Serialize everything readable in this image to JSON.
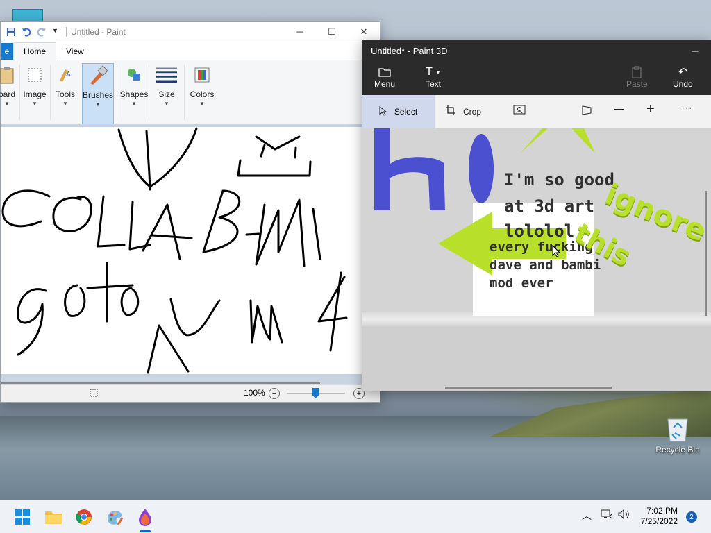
{
  "paint": {
    "title": "Untitled - Paint",
    "file_tab": "e",
    "tabs": [
      "Home",
      "View"
    ],
    "ribbon": {
      "clipboard": "oard",
      "image": "Image",
      "tools": "Tools",
      "brushes": "Brushes",
      "shapes": "Shapes",
      "size": "Size",
      "colors": "Colors"
    },
    "zoom": "100%",
    "zoom_minus": "−",
    "zoom_plus": "+"
  },
  "paint3d": {
    "title": "Untitled* - Paint 3D",
    "toolbar": {
      "menu": "Menu",
      "text": "Text",
      "paste": "Paste",
      "undo": "Undo"
    },
    "bar": {
      "select": "Select",
      "crop": "Crop"
    },
    "scene": {
      "line1": "I'm so good",
      "line2": "at 3d art",
      "line3": "lololol",
      "line4": "every fucking",
      "line5": "dave and bambi",
      "line6": "mod ever",
      "ignore": "ignore",
      "this": "this",
      "hi": "hi"
    }
  },
  "desktop": {
    "recycle_bin": "Recycle Bin"
  },
  "taskbar": {
    "time": "7:02 PM",
    "date": "7/25/2022",
    "notifications": "2"
  },
  "colors": {
    "accent": "#1979ca",
    "lime": "#b8e02a",
    "blue3d": "#4a50d0"
  }
}
